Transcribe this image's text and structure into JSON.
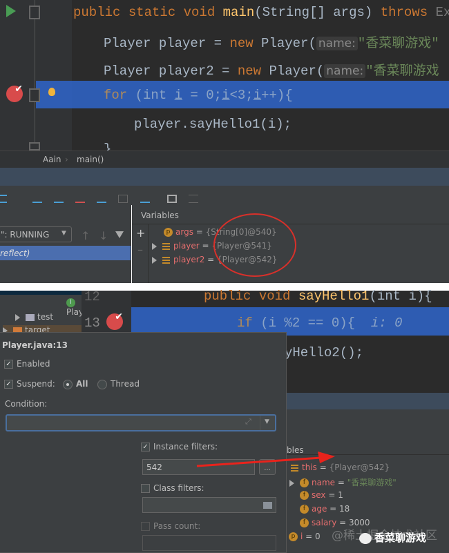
{
  "top": {
    "code": {
      "line1": {
        "kw1": "public static void ",
        "fn": "main",
        "rest": "(String[] args) ",
        "kw2": "throws ",
        "tail": "Exce"
      },
      "line2": {
        "a": "Player player = ",
        "kw": "new ",
        "b": "Player(",
        "hint": "name:",
        "str": "\"香菜聊游戏\""
      },
      "line3": {
        "a": "Player player2 = ",
        "kw": "new ",
        "b": "Player(",
        "hint": "name:",
        "str": "\"香菜聊游戏"
      },
      "line4": {
        "kw": "for ",
        "a": "(int ",
        "i1": "i",
        " b": "",
        "b": " = ",
        "num": "0",
        "c": ";",
        "i2": "i",
        "d": "<3;",
        "i3": "i",
        "e": "++){"
      },
      "line5": "player.sayHello1(i);",
      "line6": "}"
    },
    "breadcrumb": [
      "Aain",
      "main()"
    ],
    "frames": {
      "thread": "\": RUNNING",
      "selected": "reflect)"
    },
    "variables": {
      "header": "Variables",
      "items": [
        {
          "badge": "p",
          "name": "args",
          "value": "{String[0]@540}"
        },
        {
          "name": "player",
          "value": "{Player@541}"
        },
        {
          "name": "player2",
          "value": "{Player@542}"
        }
      ]
    },
    "annotation_color": "#d9302a"
  },
  "bottom": {
    "tree": [
      "Player",
      "test",
      "target"
    ],
    "gutter": [
      "12",
      "13"
    ],
    "code": {
      "line12": {
        "kw": "public void ",
        "fn": "sayHello1",
        "rest": "(int i){"
      },
      "line13": {
        "kw": "if ",
        "a": "(i %2 == 0){",
        "hint": "i: 0"
      },
      "line14": "yHello2();"
    },
    "popup": {
      "title": "Player.java:13",
      "enabled": "Enabled",
      "suspend": "Suspend:",
      "all": "All",
      "thread": "Thread",
      "condition": "Condition:",
      "condition_value": "",
      "instance_filters": "Instance filters:",
      "instance_value": "542",
      "browse": "...",
      "class_filters": "Class filters:",
      "pass_count": "Pass count:"
    },
    "variables": {
      "header": "bles",
      "items": [
        {
          "name": "this",
          "value": "{Player@542}"
        },
        {
          "badge": "f",
          "name": "name",
          "value": "\"香菜聊游戏\""
        },
        {
          "badge": "f",
          "name": "sex",
          "value": "1"
        },
        {
          "badge": "f",
          "name": "age",
          "value": "18"
        },
        {
          "badge": "f",
          "name": "salary",
          "value": "3000"
        },
        {
          "badge": "p",
          "name": "i",
          "value": "0"
        }
      ]
    },
    "watermark": "@稀土掘金技术社区",
    "wechat_label": "香菜聊游戏"
  }
}
